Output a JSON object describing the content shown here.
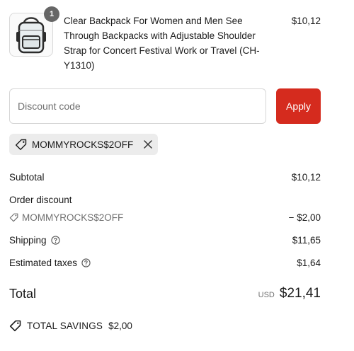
{
  "product": {
    "title": "Clear Backpack For Women and Men See Through Backpacks with Adjustable Shoulder Strap for Concert Festival Work or Travel (CH-Y1310)",
    "price": "$10,12",
    "quantity": "1",
    "image_icon": "clear-backpack-image"
  },
  "discount": {
    "placeholder": "Discount code",
    "value": "",
    "apply_label": "Apply",
    "accent_color": "#d52b1e"
  },
  "applied_code": {
    "code": "MOMMYROCKS$2OFF",
    "icon": "tag-icon",
    "remove_icon": "close-icon"
  },
  "summary": {
    "subtotal_label": "Subtotal",
    "subtotal_value": "$10,12",
    "order_discount_label": "Order discount",
    "discount_code": "MOMMYROCKS$2OFF",
    "discount_value": "− $2,00",
    "shipping_label": "Shipping",
    "shipping_value": "$11,65",
    "taxes_label": "Estimated taxes",
    "taxes_value": "$1,64",
    "total_label": "Total",
    "currency": "USD",
    "total_value": "$21,41"
  },
  "savings": {
    "label": "TOTAL SAVINGS",
    "value": "$2,00"
  }
}
